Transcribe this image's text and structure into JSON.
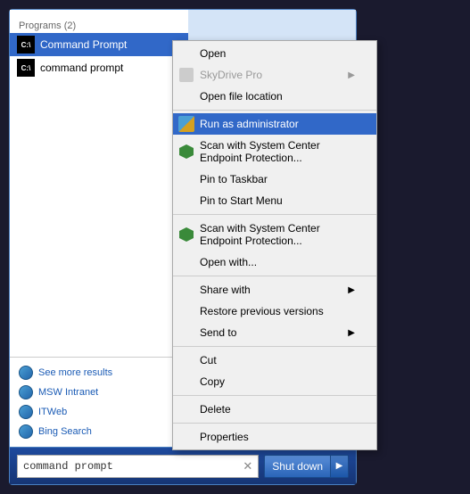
{
  "startMenu": {
    "programsTitle": "Programs (2)",
    "programs": [
      {
        "name": "Command Prompt",
        "selected": true
      },
      {
        "name": "command prompt",
        "selected": false
      }
    ],
    "links": [
      {
        "label": "See more results"
      },
      {
        "label": "MSW Intranet"
      },
      {
        "label": "ITWeb"
      },
      {
        "label": "Bing Search"
      }
    ],
    "searchValue": "command prompt",
    "searchPlaceholder": "command prompt",
    "shutdownLabel": "Shut down"
  },
  "contextMenu": {
    "items": [
      {
        "label": "Open",
        "type": "normal"
      },
      {
        "label": "SkyDrive Pro",
        "type": "disabled",
        "hasArrow": true
      },
      {
        "label": "Open file location",
        "type": "normal"
      },
      {
        "label": "Run as administrator",
        "type": "highlighted",
        "hasIcon": "uac"
      },
      {
        "label": "Scan with System Center Endpoint Protection...",
        "type": "normal",
        "hasIcon": "green-shield"
      },
      {
        "label": "Pin to Taskbar",
        "type": "normal"
      },
      {
        "label": "Pin to Start Menu",
        "type": "normal"
      },
      {
        "label": "Scan with System Center Endpoint Protection...",
        "type": "normal",
        "hasIcon": "green-shield"
      },
      {
        "label": "Open with...",
        "type": "normal"
      },
      {
        "label": "Share with",
        "type": "normal",
        "hasArrow": true
      },
      {
        "label": "Restore previous versions",
        "type": "normal"
      },
      {
        "label": "Send to",
        "type": "normal",
        "hasArrow": true
      },
      {
        "label": "Cut",
        "type": "normal"
      },
      {
        "label": "Copy",
        "type": "normal"
      },
      {
        "label": "Delete",
        "type": "normal"
      },
      {
        "label": "Properties",
        "type": "normal"
      }
    ]
  }
}
